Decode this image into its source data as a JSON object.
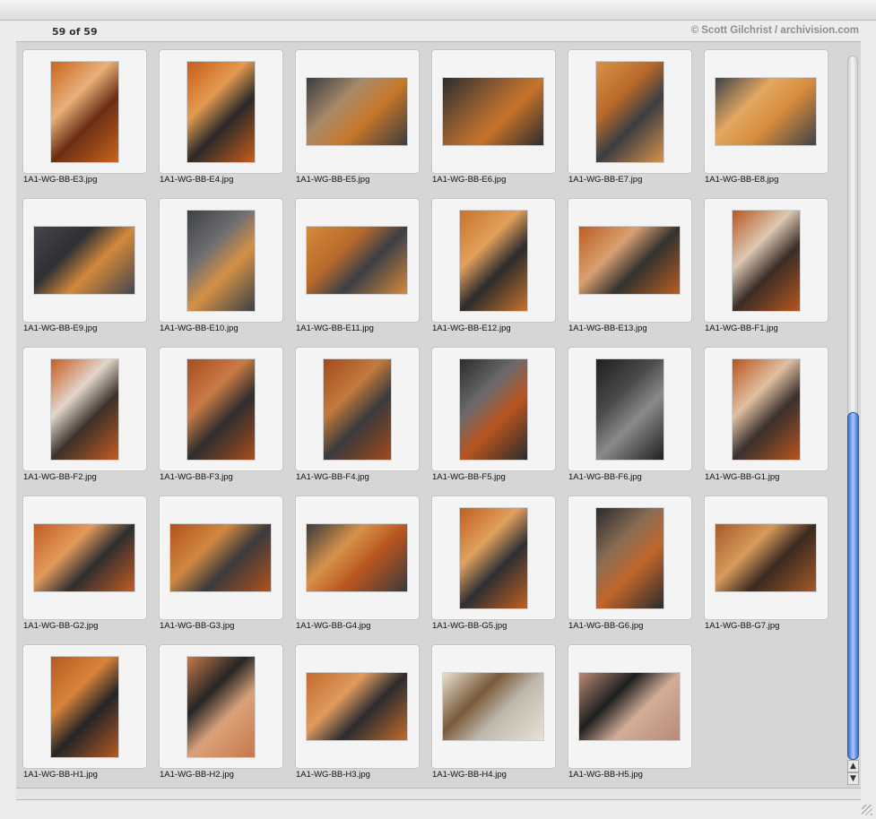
{
  "status": {
    "count": "59 of 59"
  },
  "credit": "© Scott Gilchrist / archivision.com",
  "thumbnails": [
    {
      "label": "1A1-WG-BB-E3.jpg",
      "orient": "portrait",
      "colors": [
        "#c9651e",
        "#6b2e12",
        "#e8b07a"
      ]
    },
    {
      "label": "1A1-WG-BB-E4.jpg",
      "orient": "portrait",
      "colors": [
        "#c85c18",
        "#2b2a2a",
        "#e39a4f"
      ]
    },
    {
      "label": "1A1-WG-BB-E5.jpg",
      "orient": "landscape",
      "colors": [
        "#3a3b3f",
        "#c9792a",
        "#a88a6a"
      ]
    },
    {
      "label": "1A1-WG-BB-E6.jpg",
      "orient": "landscape",
      "colors": [
        "#2d2c2e",
        "#c8732a",
        "#8a5a33"
      ]
    },
    {
      "label": "1A1-WG-BB-E7.jpg",
      "orient": "portrait",
      "colors": [
        "#d9924a",
        "#3b3d43",
        "#b86a2a"
      ]
    },
    {
      "label": "1A1-WG-BB-E8.jpg",
      "orient": "landscape",
      "colors": [
        "#3f4147",
        "#d58b3d",
        "#e3a862"
      ]
    },
    {
      "label": "1A1-WG-BB-E9.jpg",
      "orient": "landscape",
      "colors": [
        "#44464c",
        "#d4893a",
        "#2e3035"
      ]
    },
    {
      "label": "1A1-WG-BB-E10.jpg",
      "orient": "portrait",
      "colors": [
        "#3d4046",
        "#d39146",
        "#6e6e72"
      ]
    },
    {
      "label": "1A1-WG-BB-E11.jpg",
      "orient": "landscape",
      "colors": [
        "#d48a3c",
        "#3c3f45",
        "#b86a2a"
      ]
    },
    {
      "label": "1A1-WG-BB-E12.jpg",
      "orient": "portrait",
      "colors": [
        "#c7732c",
        "#2c2b2d",
        "#e2a05a"
      ]
    },
    {
      "label": "1A1-WG-BB-E13.jpg",
      "orient": "landscape",
      "colors": [
        "#b95d22",
        "#33322f",
        "#d9a070"
      ]
    },
    {
      "label": "1A1-WG-BB-F1.jpg",
      "orient": "portrait",
      "colors": [
        "#b8561f",
        "#3a2d27",
        "#dcc8b3"
      ]
    },
    {
      "label": "1A1-WG-BB-F2.jpg",
      "orient": "portrait",
      "colors": [
        "#c45c21",
        "#3b302b",
        "#e3d6c9"
      ]
    },
    {
      "label": "1A1-WG-BB-F3.jpg",
      "orient": "portrait",
      "colors": [
        "#a94d1f",
        "#2f2d2c",
        "#c97b45"
      ]
    },
    {
      "label": "1A1-WG-BB-F4.jpg",
      "orient": "portrait",
      "colors": [
        "#a24a1c",
        "#3a3a3c",
        "#c47a3c"
      ]
    },
    {
      "label": "1A1-WG-BB-F5.jpg",
      "orient": "portrait",
      "colors": [
        "#2c2c2e",
        "#b9541e",
        "#6b6b6b"
      ]
    },
    {
      "label": "1A1-WG-BB-F6.jpg",
      "orient": "portrait",
      "colors": [
        "#1f1f21",
        "#8a8a8a",
        "#4a4a4c"
      ]
    },
    {
      "label": "1A1-WG-BB-G1.jpg",
      "orient": "portrait",
      "colors": [
        "#b8531d",
        "#3a302c",
        "#e1c0a1"
      ]
    },
    {
      "label": "1A1-WG-BB-G2.jpg",
      "orient": "landscape",
      "colors": [
        "#c15c22",
        "#2f2e30",
        "#e29b5c"
      ]
    },
    {
      "label": "1A1-WG-BB-G3.jpg",
      "orient": "landscape",
      "colors": [
        "#b2501d",
        "#3a3a3d",
        "#d0893f"
      ]
    },
    {
      "label": "1A1-WG-BB-G4.jpg",
      "orient": "landscape",
      "colors": [
        "#3a393c",
        "#b8561e",
        "#d6924c"
      ]
    },
    {
      "label": "1A1-WG-BB-G5.jpg",
      "orient": "portrait",
      "colors": [
        "#c1601f",
        "#2f2f33",
        "#e0a05e"
      ]
    },
    {
      "label": "1A1-WG-BB-G6.jpg",
      "orient": "portrait",
      "colors": [
        "#2b2b2e",
        "#c1662b",
        "#8a6d55"
      ]
    },
    {
      "label": "1A1-WG-BB-G7.jpg",
      "orient": "landscape",
      "colors": [
        "#a55a28",
        "#3a2a20",
        "#d89a5a"
      ]
    },
    {
      "label": "1A1-WG-BB-H1.jpg",
      "orient": "portrait",
      "colors": [
        "#b55a22",
        "#252527",
        "#d8843a"
      ]
    },
    {
      "label": "1A1-WG-BB-H2.jpg",
      "orient": "portrait",
      "colors": [
        "#c77848",
        "#d9a27a",
        "#252525"
      ]
    },
    {
      "label": "1A1-WG-BB-H3.jpg",
      "orient": "landscape",
      "colors": [
        "#c46a2e",
        "#2b2c2e",
        "#de9a5e"
      ]
    },
    {
      "label": "1A1-WG-BB-H4.jpg",
      "orient": "landscape",
      "colors": [
        "#e8e2d4",
        "#bfb9ad",
        "#7a5a3a"
      ]
    },
    {
      "label": "1A1-WG-BB-H5.jpg",
      "orient": "landscape",
      "colors": [
        "#b98a74",
        "#d2ad98",
        "#1f1f1f"
      ]
    }
  ]
}
